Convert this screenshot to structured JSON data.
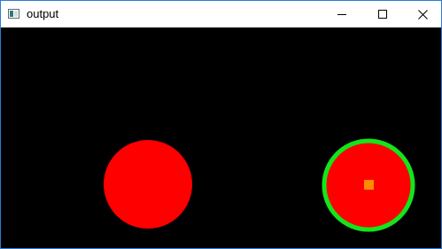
{
  "window": {
    "title": "output",
    "controls": {
      "minimize_icon": "minimize-icon",
      "maximize_icon": "maximize-icon",
      "close_icon": "close-icon"
    }
  },
  "canvas": {
    "background_color": "#000000",
    "circle_fill_color": "#ff0000",
    "ring_color": "#12e61a",
    "marker_color": "#ff8c00"
  }
}
